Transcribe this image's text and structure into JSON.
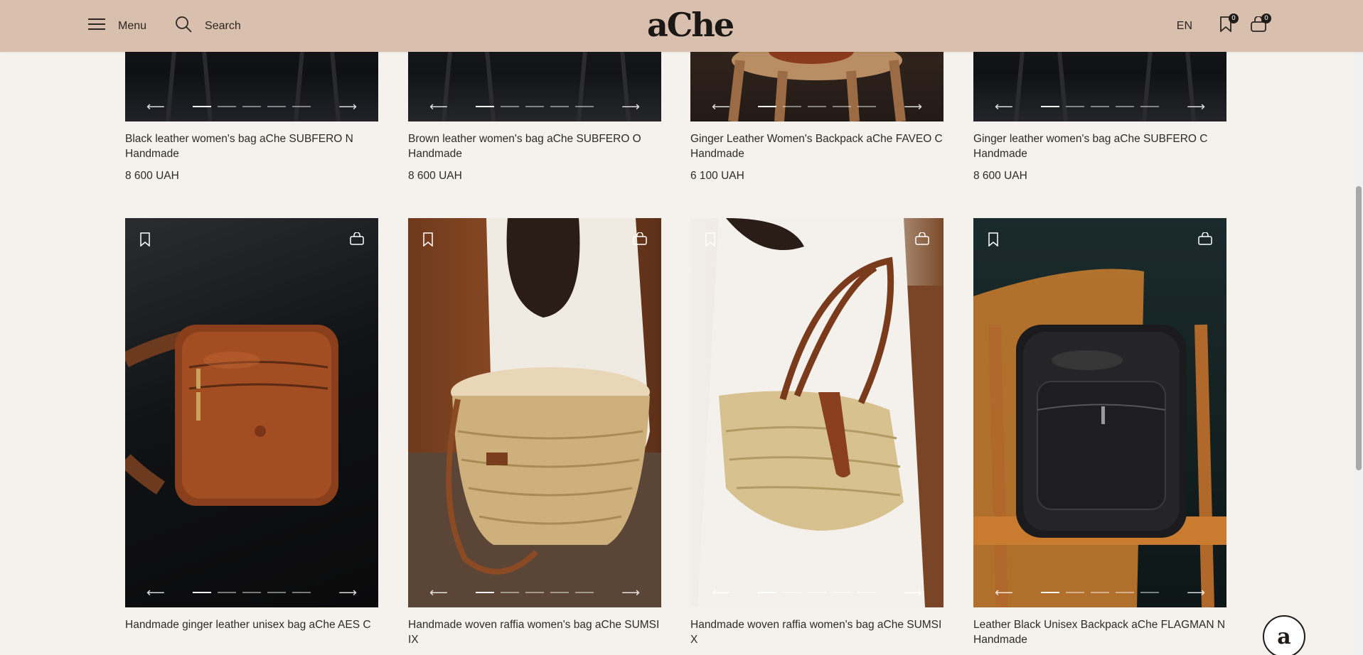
{
  "header": {
    "menu_label": "Menu",
    "search_label": "Search",
    "logo": "aChe",
    "language": "EN",
    "favorites_count": "0",
    "cart_count": "0"
  },
  "colors": {
    "header_bg": "#d9bfad",
    "page_bg": "#f5f2ee",
    "text": "#2a2622"
  },
  "carousel": {
    "prev": "⟵",
    "next": "⟶"
  },
  "products_row1": [
    {
      "title": "Black leather women's bag aChe SUBFERO N Handmade",
      "price": "8 600 UAH"
    },
    {
      "title": "Brown leather women's bag aChe SUBFERO O Handmade",
      "price": "8 600 UAH"
    },
    {
      "title": "Ginger Leather Women's Backpack aChe FAVEO C Handmade",
      "price": "6 100 UAH"
    },
    {
      "title": "Ginger leather women's bag aChe SUBFERO C Handmade",
      "price": "8 600 UAH"
    }
  ],
  "products_row2": [
    {
      "title": "Handmade ginger leather unisex bag aChe AES C"
    },
    {
      "title": "Handmade woven raffia women's bag aChe SUMSI IX"
    },
    {
      "title": "Handmade woven raffia women's bag aChe SUMSI X"
    },
    {
      "title": "Leather Black Unisex Backpack aChe FLAGMAN N Handmade"
    }
  ],
  "chat": {
    "label": "a"
  }
}
